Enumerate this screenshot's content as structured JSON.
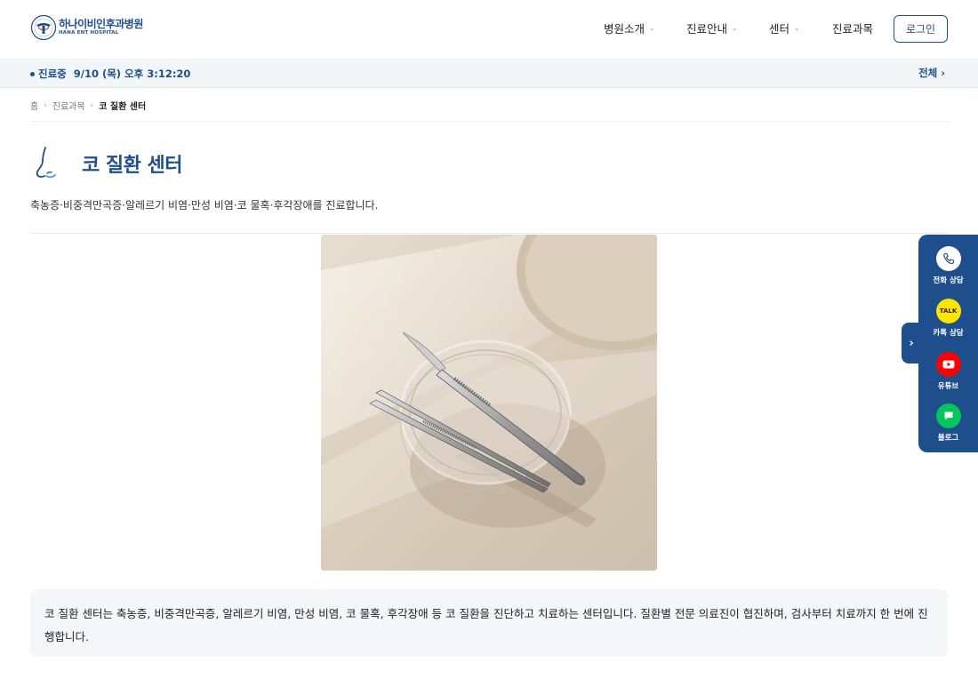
{
  "header": {
    "logo_text_ko": "하나이비인후과병원",
    "logo_text_en": "HANA ENT HOSPITAL",
    "nav": [
      {
        "label": "병원소개",
        "has_dropdown": true
      },
      {
        "label": "진료안내",
        "has_dropdown": true
      },
      {
        "label": "센터",
        "has_dropdown": true
      },
      {
        "label": "진료과목",
        "has_dropdown": false
      }
    ],
    "login_label": "로그인"
  },
  "status": {
    "label": "진료중",
    "datetime": "9/10 (목) 오후 3:12:20",
    "all_link": "전체 ›"
  },
  "breadcrumb": {
    "items": [
      "홈",
      "진료과목",
      "코 질환 센터"
    ]
  },
  "page": {
    "title": "코 질환 센터",
    "subtitle": "축농증·비중격만곡증·알레르기 비염·만성 비염·코 물혹·후각장애를 진료합니다.",
    "description": "코 질환 센터는 축농증, 비중격만곡증, 알레르기 비염, 만성 비염, 코 물혹, 후각장애 등 코 질환을 진단하고 치료하는 센터입니다. 질환별 전문 의료진이 협진하며, 검사부터 치료까지 한 번에 진행합니다."
  },
  "side_panel": {
    "items": [
      {
        "label": "전화 상담",
        "icon": "phone-icon",
        "color": "#ffffff"
      },
      {
        "label": "카톡 상담",
        "icon": "kakaotalk-icon",
        "badge": "TALK",
        "color": "#fee500"
      },
      {
        "label": "유튜브",
        "icon": "youtube-icon",
        "color": "#ff0000"
      },
      {
        "label": "블로그",
        "icon": "blog-icon",
        "color": "#03c75a"
      }
    ]
  },
  "colors": {
    "brand": "#1f4e8c",
    "status_bg": "#f3f6f9",
    "desc_bg": "#f4f7fa"
  }
}
